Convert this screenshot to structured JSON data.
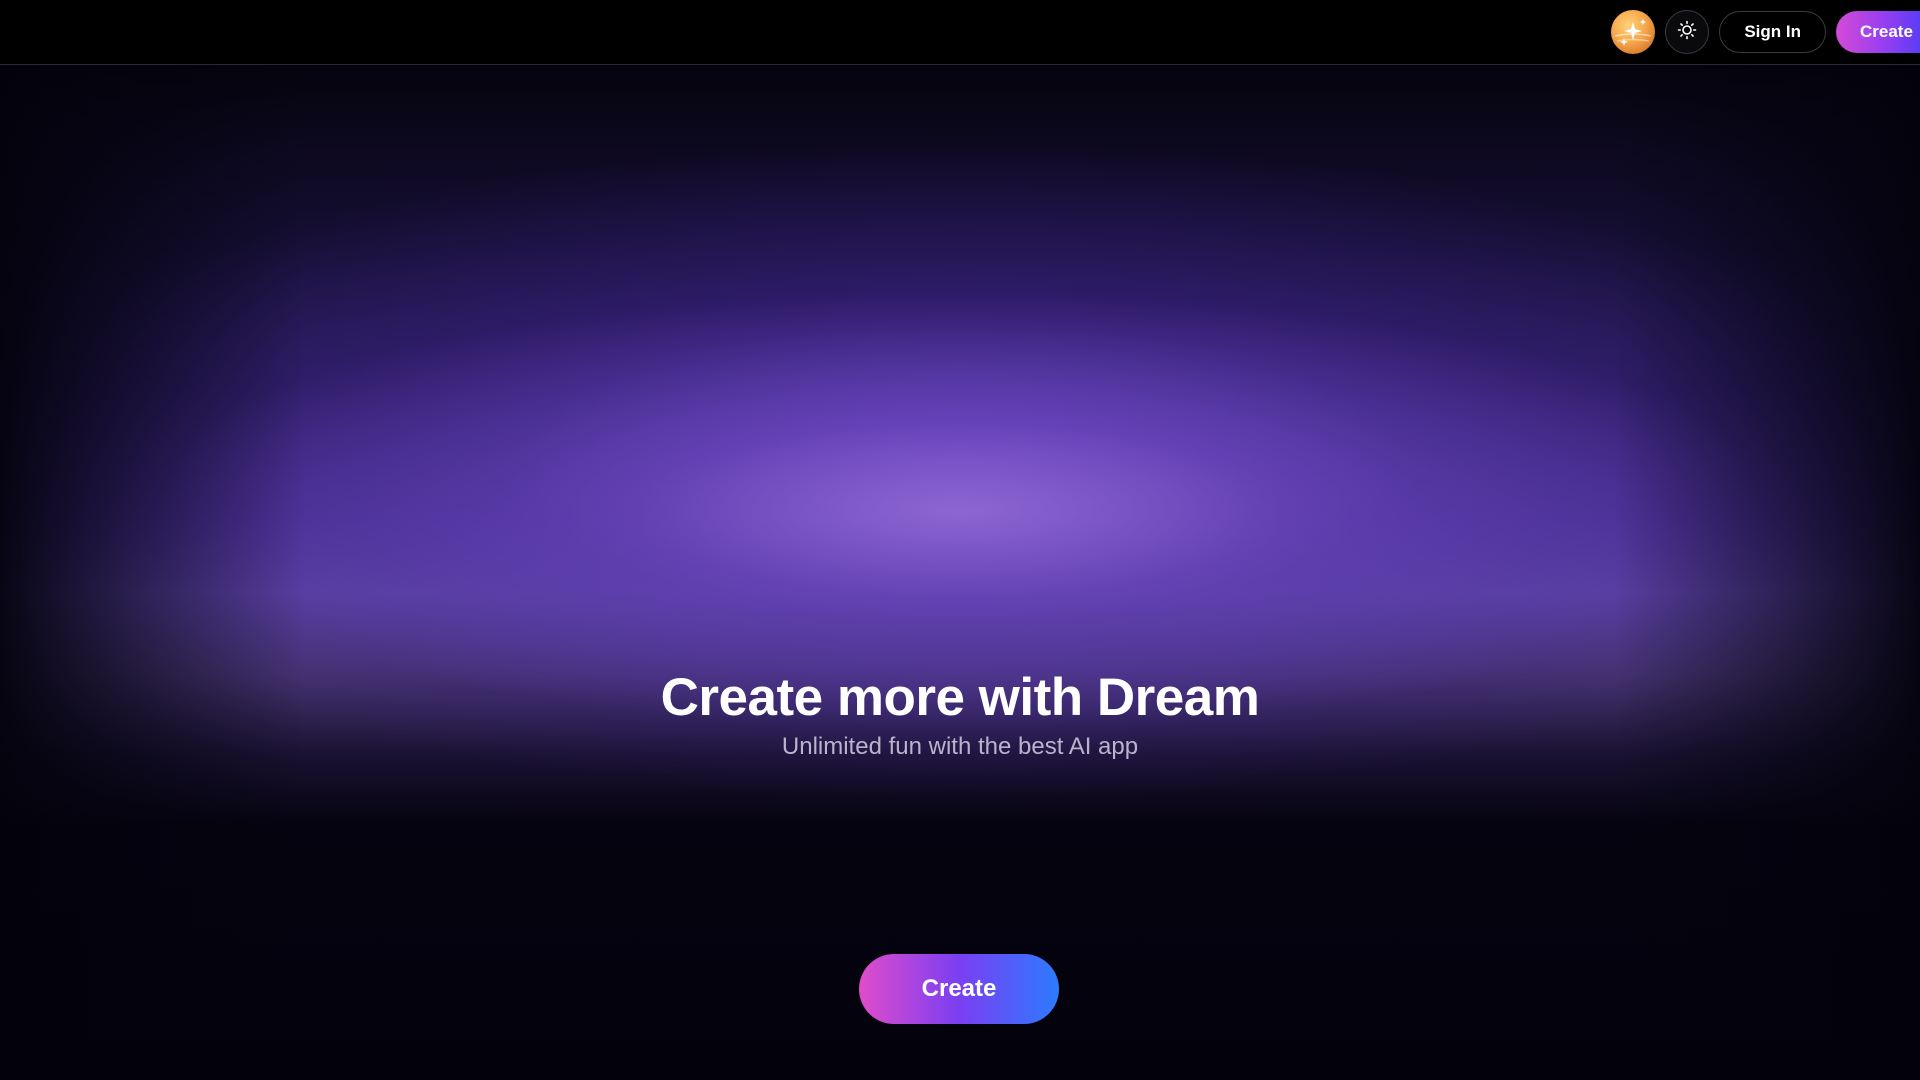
{
  "header": {
    "avatar_icon": "sparkle-avatar-icon",
    "theme_icon": "sun-icon",
    "signin_label": "Sign In",
    "create_label": "Create"
  },
  "hero": {
    "title": "Create more with Dream",
    "subtitle": "Unlimited fun with the best AI app",
    "cta_label": "Create"
  },
  "colors": {
    "background": "#03020f",
    "glow": "#7c5cc4",
    "cta_gradient_start": "#e04ccb",
    "cta_gradient_end": "#2c7bff"
  }
}
